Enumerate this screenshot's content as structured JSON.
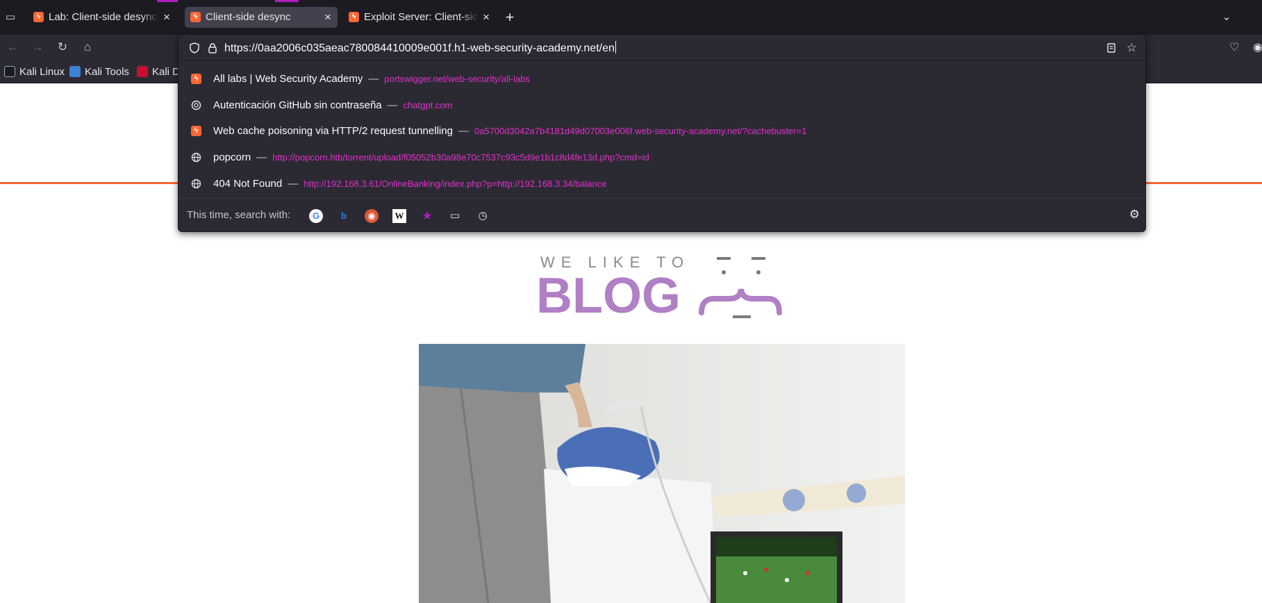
{
  "tabs": [
    {
      "title": "Lab: Client-side desync | Web Security Academy",
      "active": false
    },
    {
      "title": "Client-side desync",
      "active": true
    },
    {
      "title": "Exploit Server: Client-side desync",
      "active": false
    }
  ],
  "new_tab_symbol": "+",
  "bookmarks": [
    {
      "label": "Kali Linux",
      "icon": "kali-dragon-icon"
    },
    {
      "label": "Kali Tools",
      "icon": "kali-tools-icon"
    },
    {
      "label": "Kali Docs",
      "icon": "kali-docs-icon"
    }
  ],
  "urlbar": {
    "value": "https://0aa2006c035aeac780084410009e001f.h1-web-security-academy.net/en"
  },
  "results": [
    {
      "icon": "portswigger-icon",
      "title": "All labs | Web Security Academy",
      "sep": "—",
      "url": "portswigger.net/web-security/all-labs"
    },
    {
      "icon": "chatgpt-icon",
      "title": "Autenticación GitHub sin contraseña",
      "sep": "—",
      "url": "chatgpt.com"
    },
    {
      "icon": "portswigger-icon",
      "title": "Web cache poisoning via HTTP/2 request tunnelling",
      "sep": "—",
      "url": "0a5700d3042a7b4181d49d07003e006f.web-security-academy.net/?cachebuster=1"
    },
    {
      "icon": "globe-icon",
      "title": "popcorn",
      "sep": "—",
      "url": "http://popcorn.htb/torrent/upload/f05052b30a98e70c7537c93c5d9e1b1c8d4fe13d.php?cmd=id"
    },
    {
      "icon": "globe-icon",
      "title": "404 Not Found",
      "sep": "—",
      "url": "http://192.168.3.61/OnlineBanking/index.php?p=http://192.168.3.34/balance"
    }
  ],
  "search_with": {
    "label": "This time, search with:",
    "engines": [
      "google-icon",
      "bing-icon",
      "duckduckgo-icon",
      "wikipedia-icon",
      "bookmarks-icon",
      "tabs-icon",
      "history-icon"
    ]
  },
  "blog_logo": {
    "line1": "WE LIKE TO",
    "line2": "BLOG",
    "color": "#b07fc4"
  },
  "colors": {
    "accent": "#b01ec3",
    "url_link": "#e131c9",
    "brand_orange": "#ff6633"
  }
}
